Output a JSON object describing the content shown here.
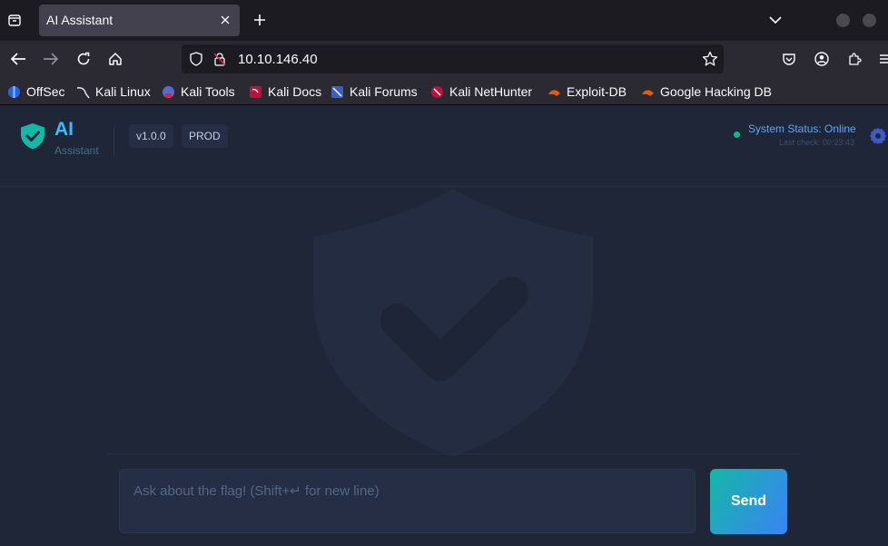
{
  "browser": {
    "tab_title": "AI Assistant",
    "url": "10.10.146.40",
    "bookmarks": [
      {
        "label": "OffSec",
        "icon": "offsec-icon",
        "color": "#3b82f6"
      },
      {
        "label": "Kali Linux",
        "icon": "kali-dragon-icon",
        "color": "#ffffff"
      },
      {
        "label": "Kali Tools",
        "icon": "kali-tools-icon",
        "color": "#5b7bd5"
      },
      {
        "label": "Kali Docs",
        "icon": "kali-docs-icon",
        "color": "#e11d48"
      },
      {
        "label": "Kali Forums",
        "icon": "kali-forums-icon",
        "color": "#4f7ad6"
      },
      {
        "label": "Kali NetHunter",
        "icon": "nethunter-icon",
        "color": "#e11d48"
      },
      {
        "label": "Exploit-DB",
        "icon": "exploit-db-icon",
        "color": "#ea580c"
      },
      {
        "label": "Google Hacking DB",
        "icon": "ghdb-icon",
        "color": "#ea580c"
      }
    ]
  },
  "app": {
    "logo_title": "AI",
    "logo_subtitle": "Assistant",
    "version_badge": "v1.0.0",
    "env_badge": "PROD",
    "status_text": "System Status: Online",
    "last_check": "Last check: 00:23:43",
    "status_color": "#10b981",
    "accent_color": "#38bdf8"
  },
  "chat": {
    "placeholder": "Ask about the flag! (Shift+↵ for new line)",
    "value": "",
    "send_label": "Send"
  }
}
